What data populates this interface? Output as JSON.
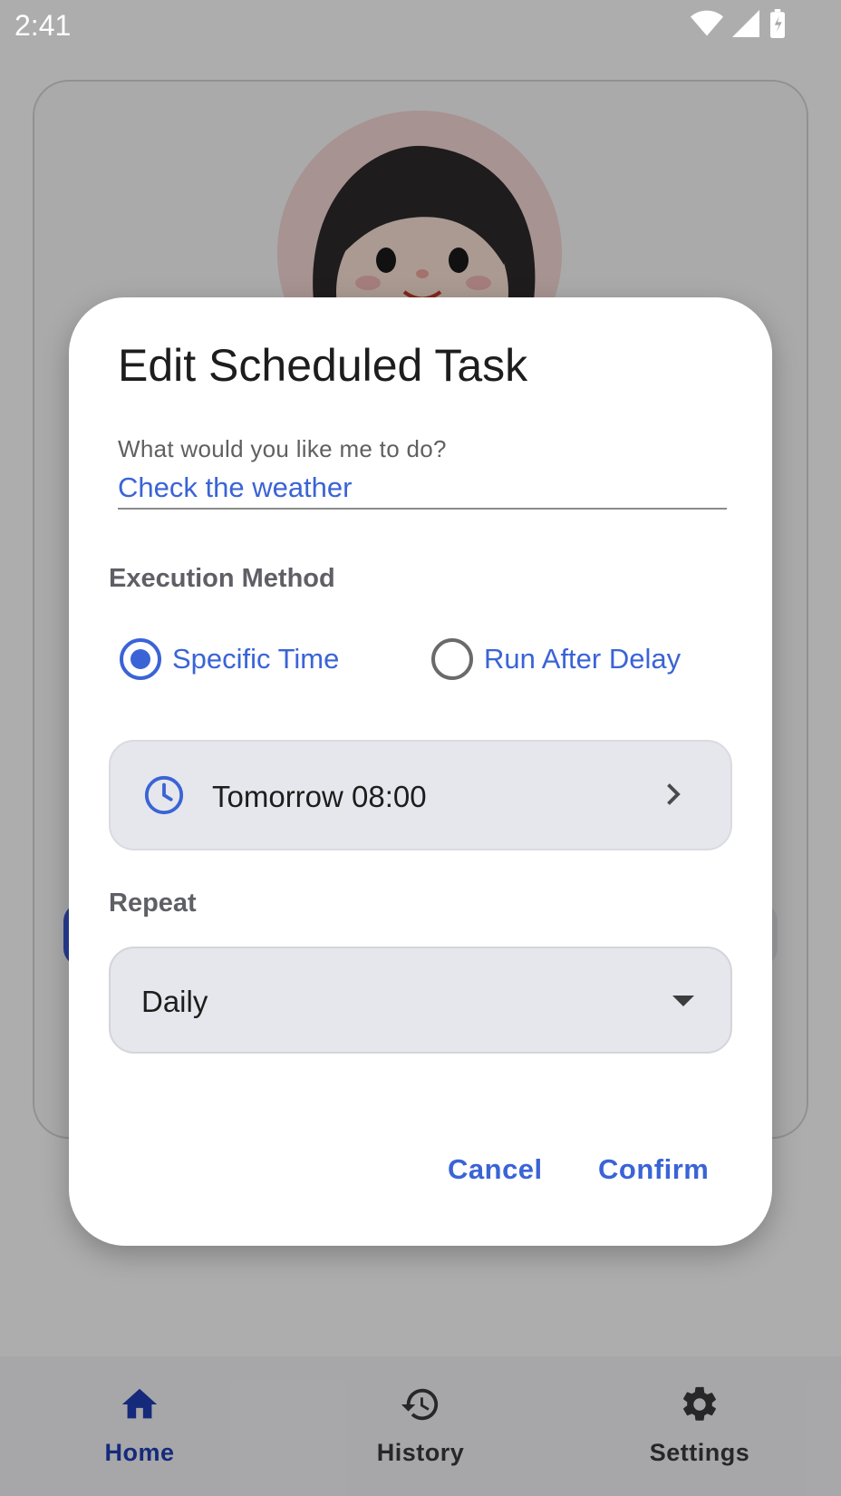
{
  "status": {
    "time": "2:41"
  },
  "dialog": {
    "title": "Edit Scheduled Task",
    "task_label": "What would you like me to do?",
    "task_value": "Check the weather",
    "execution_label": "Execution Method",
    "options": [
      {
        "label": "Specific Time",
        "selected": true
      },
      {
        "label": "Run After Delay",
        "selected": false
      }
    ],
    "time_value": "Tomorrow 08:00",
    "repeat_label": "Repeat",
    "repeat_value": "Daily",
    "cancel_label": "Cancel",
    "confirm_label": "Confirm"
  },
  "nav": {
    "items": [
      {
        "label": "Home",
        "icon": "home-icon",
        "active": true
      },
      {
        "label": "History",
        "icon": "history-icon",
        "active": false
      },
      {
        "label": "Settings",
        "icon": "gear-icon",
        "active": false
      }
    ]
  },
  "colors": {
    "accent": "#3a64d6",
    "nav_active": "#1f3fb5",
    "scrim": "rgba(0,0,0,0.32)"
  }
}
